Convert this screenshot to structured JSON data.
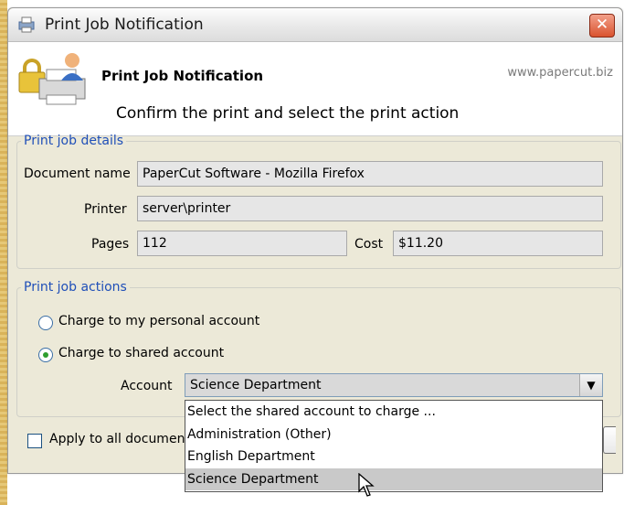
{
  "window": {
    "title": "Print Job Notification",
    "close_label": "✕"
  },
  "header": {
    "title": "Print Job Notification",
    "subtitle": "Confirm the print and select the print action",
    "url": "www.papercut.biz"
  },
  "details": {
    "legend": "Print job details",
    "document_label": "Document name",
    "document_value": "PaperCut Software - Mozilla Firefox",
    "printer_label": "Printer",
    "printer_value": "server\\printer",
    "pages_label": "Pages",
    "pages_value": "112",
    "cost_label": "Cost",
    "cost_value": "$11.20"
  },
  "actions": {
    "legend": "Print job actions",
    "personal_label": "Charge to my personal account",
    "shared_label": "Charge to shared account",
    "account_label": "Account",
    "account_value": "Science Department",
    "options": [
      "Select the shared account to charge ...",
      "Administration (Other)",
      "English Department",
      "Science Department"
    ]
  },
  "footer": {
    "apply_label": "Apply to all documen"
  },
  "colors": {
    "legend": "#1f4fb8",
    "close": "#d9532f"
  }
}
